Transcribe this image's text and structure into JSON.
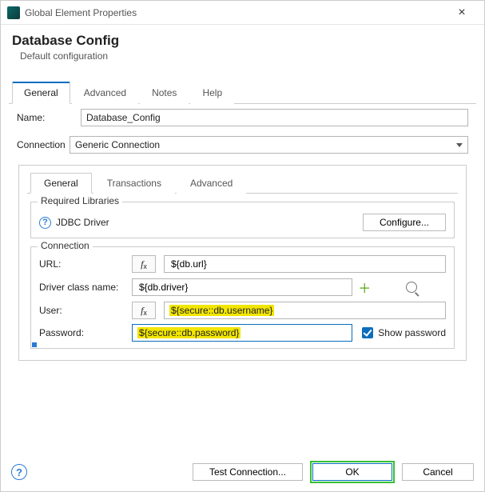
{
  "window": {
    "title": "Global Element Properties"
  },
  "header": {
    "title": "Database Config",
    "subtitle": "Default configuration"
  },
  "outerTabs": {
    "items": [
      "General",
      "Advanced",
      "Notes",
      "Help"
    ],
    "active": 0
  },
  "nameRow": {
    "label": "Name:",
    "value": "Database_Config"
  },
  "connectionRow": {
    "label": "Connection",
    "value": "Generic Connection"
  },
  "innerTabs": {
    "items": [
      "General",
      "Transactions",
      "Advanced"
    ],
    "active": 0
  },
  "requiredLibs": {
    "legend": "Required Libraries",
    "item": "JDBC Driver",
    "configureLabel": "Configure..."
  },
  "connection": {
    "legend": "Connection",
    "url": {
      "label": "URL:",
      "value": "${db.url}"
    },
    "driver": {
      "label": "Driver class name:",
      "value": "${db.driver}"
    },
    "user": {
      "label": "User:",
      "value": "${secure::db.username}"
    },
    "password": {
      "label": "Password:",
      "value": "${secure::db.password}"
    },
    "showPassword": {
      "label": "Show password",
      "checked": true
    }
  },
  "footer": {
    "test": "Test Connection...",
    "ok": "OK",
    "cancel": "Cancel"
  }
}
